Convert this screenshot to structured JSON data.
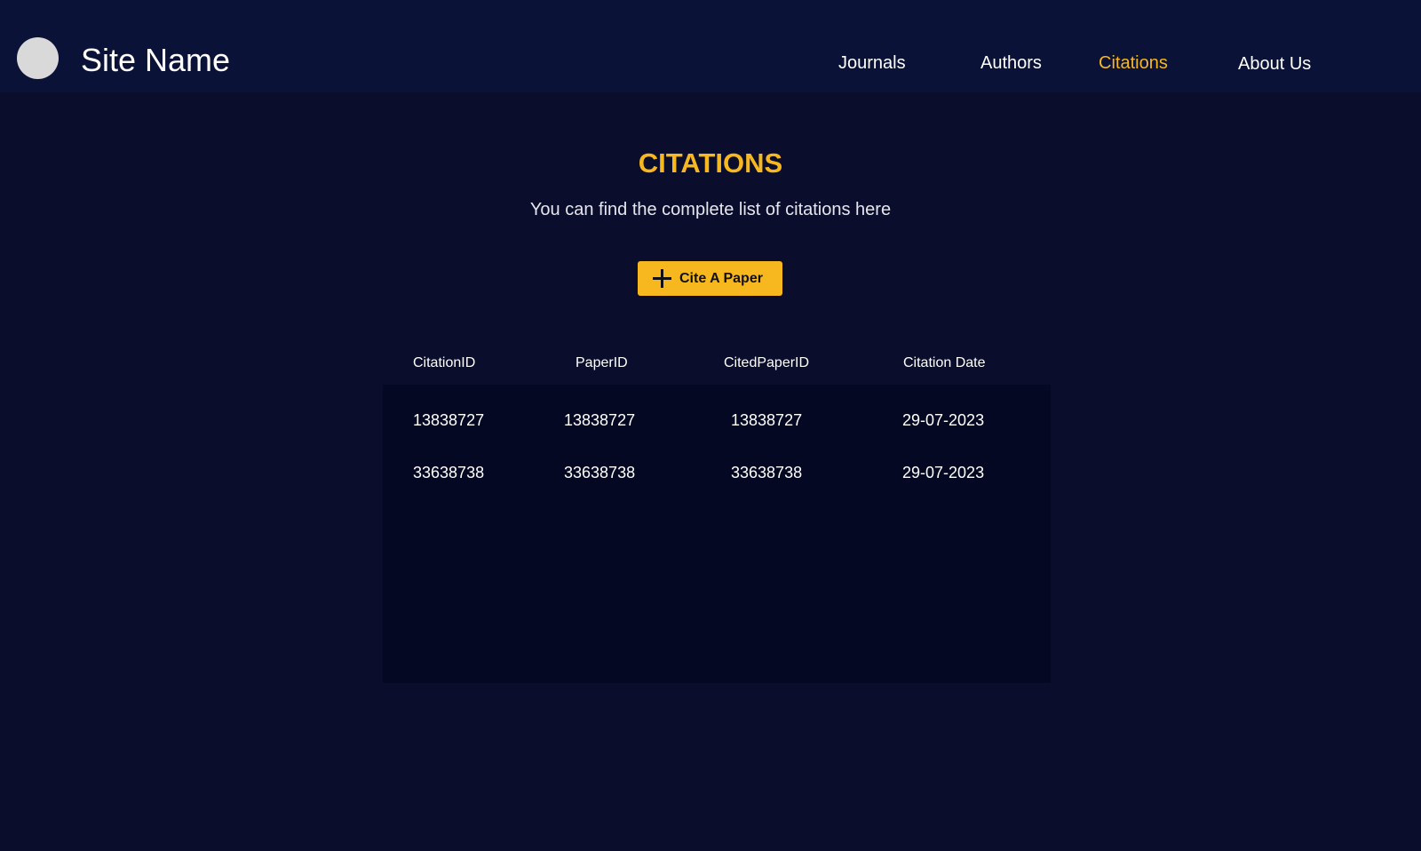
{
  "header": {
    "site_name": "Site Name",
    "nav": [
      {
        "label": "Journals",
        "active": false
      },
      {
        "label": "Authors",
        "active": false
      },
      {
        "label": "Citations",
        "active": true
      },
      {
        "label": "About Us",
        "active": false
      }
    ]
  },
  "main": {
    "title": "CITATIONS",
    "subtitle": "You can find the complete list of citations here",
    "cite_button": {
      "label": "Cite A Paper",
      "icon": "plus-icon"
    }
  },
  "table": {
    "columns": [
      "CitationID",
      "PaperID",
      "CitedPaperID",
      "Citation Date"
    ],
    "rows": [
      [
        "13838727",
        "13838727",
        "13838727",
        "29-07-2023"
      ],
      [
        "33638738",
        "33638738",
        "33638738",
        "29-07-2023"
      ]
    ]
  },
  "colors": {
    "background": "#0a0d2b",
    "navbar": "#0b1237",
    "accent": "#f6b81e",
    "table_body": "#050823",
    "text": "#ffffff"
  }
}
